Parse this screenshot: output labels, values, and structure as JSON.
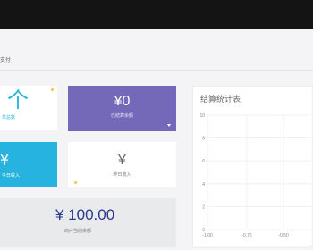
{
  "breadcrumb": "支付",
  "tiles": {
    "total_orders": {
      "icon_text": "个",
      "label": "单总数"
    },
    "settled_amount": {
      "value": "¥0",
      "label": "已结算余额"
    },
    "today_income": {
      "icon_text": "¥",
      "label": "今日收入"
    },
    "yesterday_income": {
      "value": "¥",
      "label": "昨日收入"
    },
    "account_balance": {
      "value": "¥ 100.00",
      "label": "商户当前余额"
    }
  },
  "chart": {
    "title": "结算统计表",
    "chart_data": {
      "type": "line",
      "title": "结算统计表",
      "xlabel": "",
      "ylabel": "",
      "y_ticks": [
        "10",
        "8",
        "6",
        "4",
        "2",
        "0"
      ],
      "x_ticks": [
        "-1.00",
        "-0.75",
        "-0.50"
      ],
      "ylim": [
        0,
        10
      ],
      "xlim": [
        -1,
        -0.5
      ],
      "series": []
    }
  },
  "colors": {
    "purple_tile": "#7468b8",
    "blue_tile": "#27b3df",
    "balance_text": "#2b3a8a",
    "top_bar": "#141414"
  }
}
